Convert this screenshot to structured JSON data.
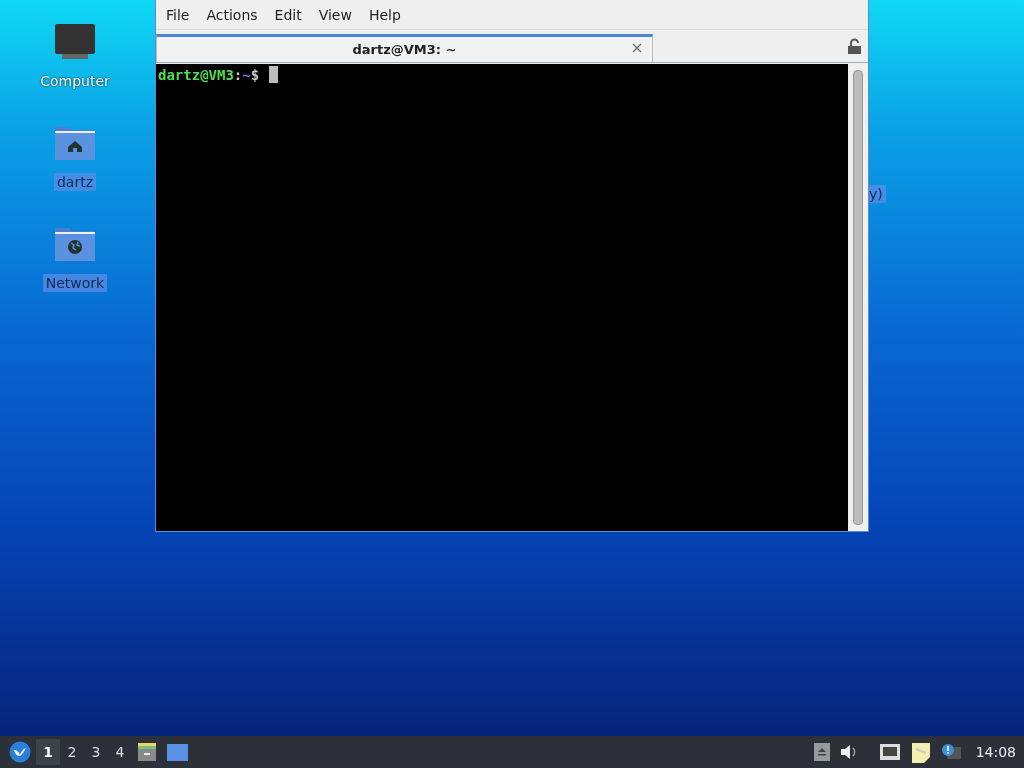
{
  "desktop_icons": [
    {
      "label": "Computer",
      "kind": "computer",
      "selected": false
    },
    {
      "label": "dartz",
      "kind": "home",
      "selected": true
    },
    {
      "label": "Network",
      "kind": "network",
      "selected": true
    }
  ],
  "covered_icon_label": {
    "label": "y)",
    "selected": true
  },
  "window": {
    "menu": [
      "File",
      "Actions",
      "Edit",
      "View",
      "Help"
    ],
    "tabs": [
      {
        "title": "dartz@VM3: ~",
        "selected": true
      }
    ],
    "prompt": {
      "user_host": "dartz@VM3",
      "separator": ":",
      "path": "~",
      "symbol": "$"
    }
  },
  "taskbar": {
    "workspaces": [
      {
        "label": "1",
        "selected": true
      },
      {
        "label": "2",
        "selected": false
      },
      {
        "label": "3",
        "selected": false
      },
      {
        "label": "4",
        "selected": false
      }
    ],
    "clock": "14:08"
  }
}
